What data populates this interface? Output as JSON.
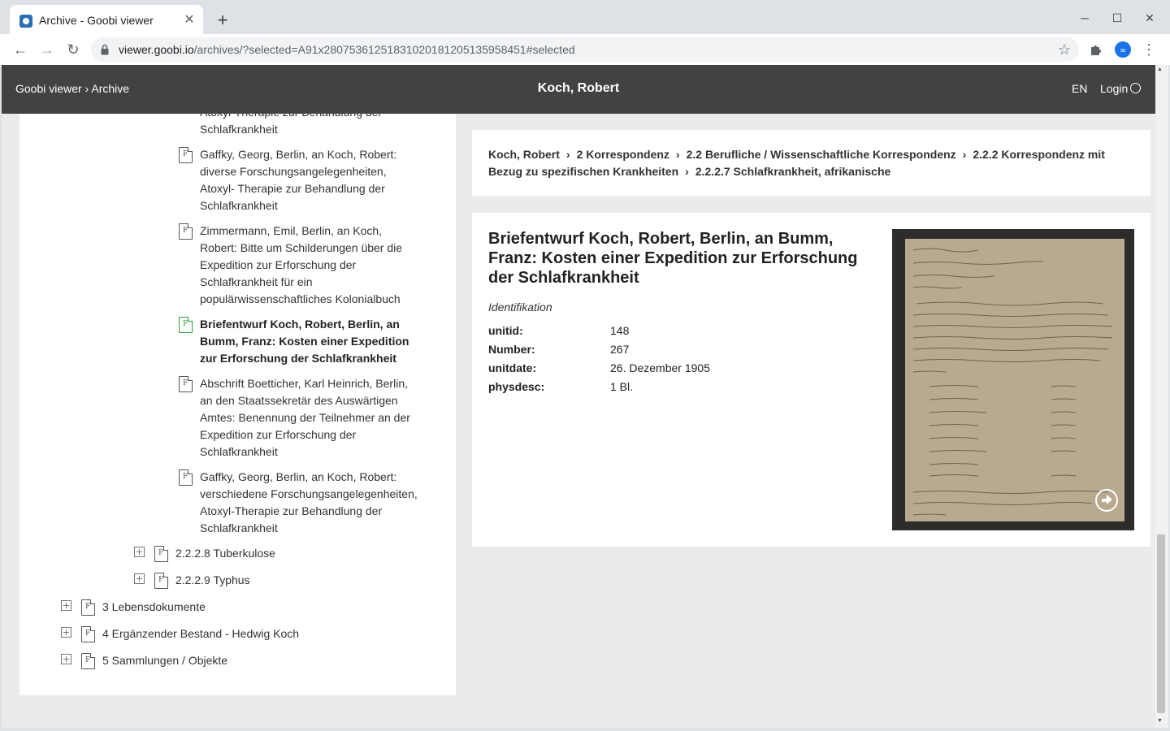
{
  "browser": {
    "tab_title": "Archive - Goobi viewer",
    "url_host": "viewer.goobi.io",
    "url_rest": "/archives/?selected=A91x280753612518310201812051359584​51#selected"
  },
  "header": {
    "breadcrumb": "Goobi viewer › Archive",
    "title": "Koch, Robert",
    "language": "EN",
    "login": "Login"
  },
  "tree": {
    "partial_top_1": "Atoxyl-Therapie zur Behandlung der",
    "partial_top_2": "Schlafkrankheit",
    "docs": [
      {
        "lines": [
          "Gaffky, Georg, Berlin, an Koch, Robert:",
          "diverse Forschungsangelegenheiten,",
          "Atoxyl- Therapie zur Behandlung der",
          "Schlafkrankheit"
        ]
      },
      {
        "lines": [
          "Zimmermann, Emil, Berlin, an Koch,",
          "Robert: Bitte um Schilderungen über die",
          "Expedition zur Erforschung der",
          "Schlafkrankheit für ein",
          "populärwissenschaftliches Kolonialbuch"
        ]
      },
      {
        "lines": [
          "Briefentwurf Koch, Robert, Berlin, an",
          "Bumm, Franz: Kosten einer Expedition",
          "zur Erforschung der Schlafkrankheit"
        ]
      },
      {
        "lines": [
          "Abschrift Boetticher, Karl Heinrich, Berlin,",
          "an den Staatssekretär des Auswärtigen",
          "Amtes: Benennung der Teilnehmer an der",
          "Expedition zur Erforschung der",
          "Schlafkrankheit"
        ]
      },
      {
        "lines": [
          "Gaffky, Georg, Berlin, an Koch, Robert:",
          "verschiedene Forschungsangelegenheiten,",
          "Atoxyl-Therapie zur Behandlung der",
          "Schlafkrankheit"
        ]
      }
    ],
    "nodes": [
      {
        "label": "2.2.2.8 Tuberkulose"
      },
      {
        "label": "2.2.2.9 Typhus"
      },
      {
        "label": "3 Lebensdokumente"
      },
      {
        "label": "4 Ergänzender Bestand - Hedwig Koch"
      },
      {
        "label": "5 Sammlungen / Objekte"
      }
    ]
  },
  "breadcrumb_path": {
    "items": [
      "Koch, Robert",
      "2 Korrespondenz",
      "2.2 Berufliche / Wissenschaftliche Korrespondenz",
      "2.2.2 Korrespondenz mit Bezug zu spezifischen Krankheiten",
      "2.2.2.7 Schlafkrankheit, afrikanische"
    ],
    "separator": "›"
  },
  "detail": {
    "title": "Briefentwurf Koch, Robert, Berlin, an Bumm, Franz: Kosten einer Expedition zur Erforschung der Schlafkrankheit",
    "section": "Identifikation",
    "fields": [
      {
        "key": "unitid:",
        "value": "148"
      },
      {
        "key": "Number:",
        "value": "267"
      },
      {
        "key": "unitdate:",
        "value": "26. Dezember 1905"
      },
      {
        "key": "physdesc:",
        "value": "1 Bl."
      }
    ]
  },
  "colors": {
    "header_bg": "#424242",
    "active_doc": "#2e9b3a",
    "page_bg": "#ebebeb"
  }
}
